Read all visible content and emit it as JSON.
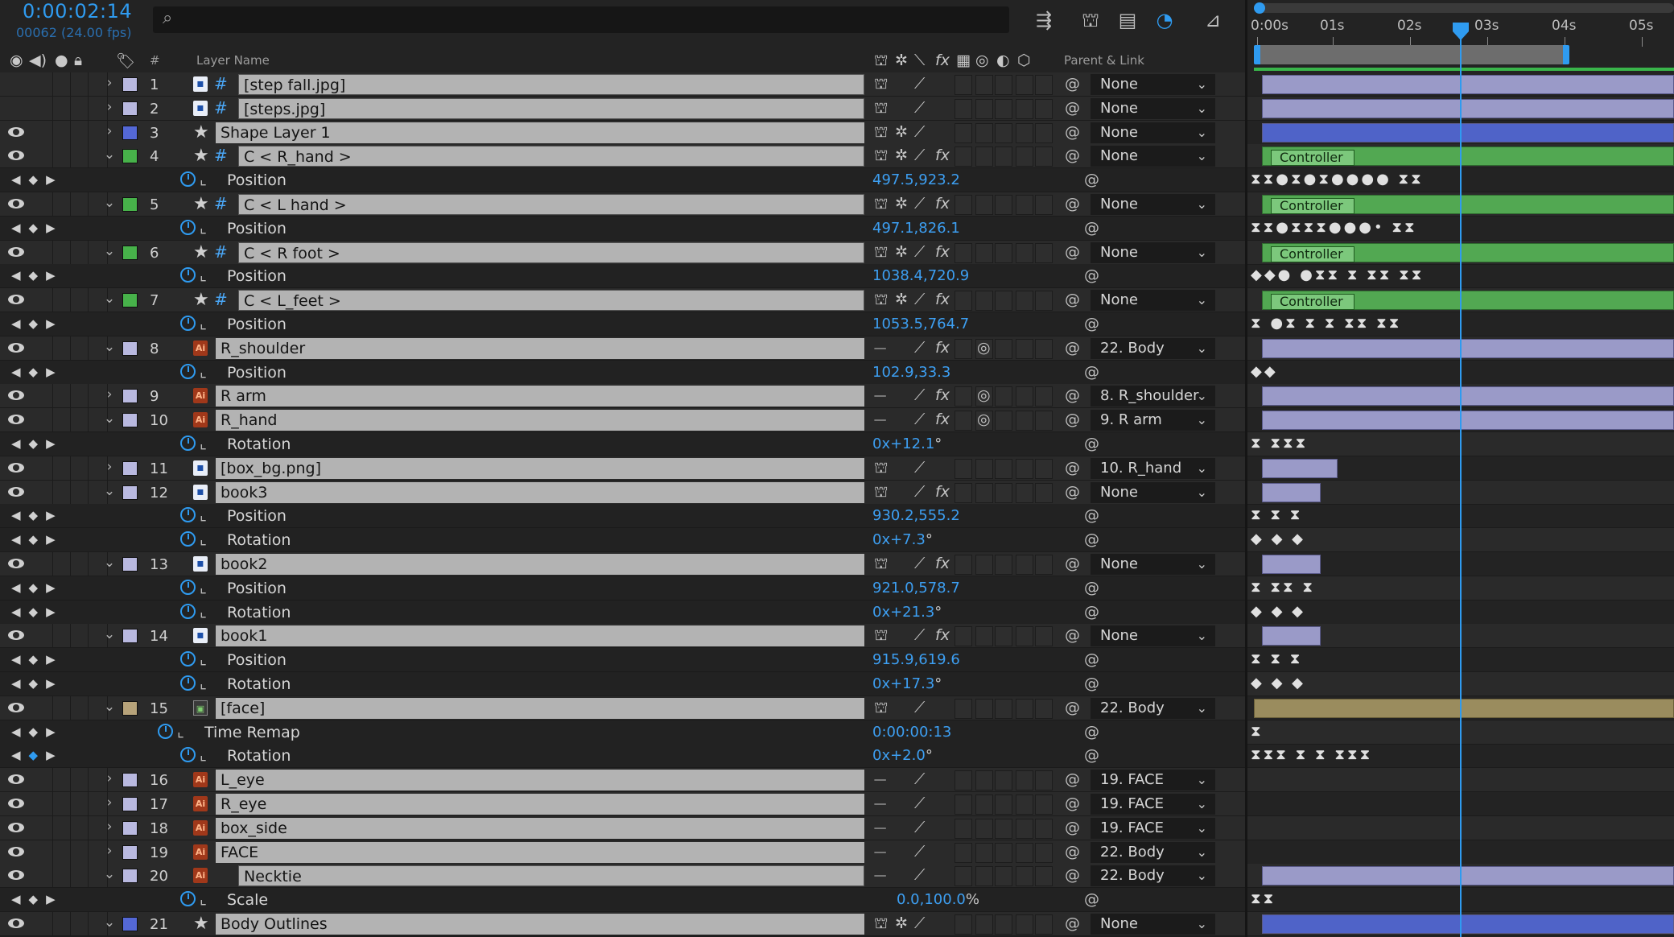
{
  "header": {
    "timecode": "0:00:02:14",
    "frame_info": "00062 (24.00 fps)",
    "search_placeholder": "",
    "col_layer_name": "Layer Name",
    "col_number": "#",
    "col_parent": "Parent & Link"
  },
  "ruler": {
    "ticks": [
      "0:00s",
      "01s",
      "02s",
      "03s",
      "04s",
      "05s"
    ]
  },
  "rows": [
    {
      "kind": "layer",
      "num": "1",
      "name": "[step fall.jpg]",
      "icon": "file",
      "hash": true,
      "color": "#b9b9e0",
      "twirl": "›",
      "parent": "None",
      "eye": false,
      "bar": "lav",
      "bar_start": 0.02,
      "bar_end": 1.0
    },
    {
      "kind": "layer",
      "num": "2",
      "name": "[steps.jpg]",
      "icon": "file",
      "hash": true,
      "color": "#b9b9e0",
      "twirl": "›",
      "parent": "None",
      "eye": false,
      "bar": "lav",
      "bar_start": 0.02,
      "bar_end": 1.0
    },
    {
      "kind": "layer",
      "num": "3",
      "name": "Shape Layer 1",
      "icon": "star",
      "hash": false,
      "color": "#5468d6",
      "twirl": "›",
      "parent": "None",
      "eye": true,
      "bar": "blue",
      "bar_start": 0.02,
      "bar_end": 1.0
    },
    {
      "kind": "layer",
      "num": "4",
      "name": "C < R_hand >",
      "icon": "star",
      "hash": true,
      "color": "#47b24a",
      "twirl": "⌄",
      "parent": "None",
      "eye": true,
      "bar": "green",
      "bar_start": 0.02,
      "bar_end": 1.0,
      "controller": "Controller"
    },
    {
      "kind": "prop",
      "name": "Position",
      "value": "497.5,923.2",
      "unit": "",
      "keys": "⧗⧗●⧗●⧗●●●● ⧗⧗"
    },
    {
      "kind": "layer",
      "num": "5",
      "name": "C < L hand >",
      "icon": "star",
      "hash": true,
      "color": "#47b24a",
      "twirl": "⌄",
      "parent": "None",
      "eye": true,
      "bar": "green",
      "bar_start": 0.02,
      "bar_end": 1.0,
      "controller": "Controller"
    },
    {
      "kind": "prop",
      "name": "Position",
      "value": "497.1,826.1",
      "unit": "",
      "keys": "⧗⧗●⧗⧗⧗●●●• ⧗⧗"
    },
    {
      "kind": "layer",
      "num": "6",
      "name": "C < R foot >",
      "icon": "star",
      "hash": true,
      "color": "#47b24a",
      "twirl": "⌄",
      "parent": "None",
      "eye": true,
      "bar": "green",
      "bar_start": 0.02,
      "bar_end": 1.0,
      "controller": "Controller"
    },
    {
      "kind": "prop",
      "name": "Position",
      "value": "1038.4,720.9",
      "unit": "",
      "keys": "◆◆● ●⧗⧗   ⧗ ⧗⧗ ⧗⧗"
    },
    {
      "kind": "layer",
      "num": "7",
      "name": "C < L_feet >",
      "icon": "star",
      "hash": true,
      "color": "#47b24a",
      "twirl": "⌄",
      "parent": "None",
      "eye": true,
      "bar": "green",
      "bar_start": 0.02,
      "bar_end": 1.0,
      "controller": "Controller"
    },
    {
      "kind": "prop",
      "name": "Position",
      "value": "1053.5,764.7",
      "unit": "",
      "keys": "⧗  ●⧗  ⧗   ⧗ ⧗⧗ ⧗⧗"
    },
    {
      "kind": "layer",
      "num": "8",
      "name": "R_shoulder",
      "icon": "ai",
      "hash": false,
      "color": "#b9b9e0",
      "twirl": "⌄",
      "parent": "22. Body",
      "eye": true,
      "bar": "lav",
      "bar_start": 0.02,
      "bar_end": 1.0
    },
    {
      "kind": "prop",
      "name": "Position",
      "value": "102.9,33.3",
      "unit": "",
      "keys": "                 ◆◆"
    },
    {
      "kind": "layer",
      "num": "9",
      "name": "R arm",
      "icon": "ai",
      "hash": false,
      "color": "#b9b9e0",
      "twirl": "›",
      "parent": "8. R_shoulder",
      "eye": true,
      "bar": "lav",
      "bar_start": 0.02,
      "bar_end": 1.0
    },
    {
      "kind": "layer",
      "num": "10",
      "name": "R_hand",
      "icon": "ai",
      "hash": false,
      "color": "#b9b9e0",
      "twirl": "⌄",
      "parent": "9. R arm",
      "eye": true,
      "bar": "lav",
      "bar_start": 0.02,
      "bar_end": 1.0
    },
    {
      "kind": "prop",
      "name": "Rotation",
      "value": "0x+12.1",
      "unit": "°",
      "keys": "                 ⧗ ⧗⧗⧗"
    },
    {
      "kind": "layer",
      "num": "11",
      "name": "[box_bg.png]",
      "icon": "file",
      "hash": false,
      "color": "#b9b9e0",
      "twirl": "›",
      "parent": "10. R_hand",
      "eye": true,
      "bar": "lav",
      "bar_start": 0.02,
      "bar_end": 0.2
    },
    {
      "kind": "layer",
      "num": "12",
      "name": "book3",
      "icon": "file",
      "hash": false,
      "color": "#b9b9e0",
      "twirl": "⌄",
      "parent": "None",
      "eye": true,
      "bar": "lav",
      "bar_start": 0.02,
      "bar_end": 0.16
    },
    {
      "kind": "prop",
      "name": "Position",
      "value": "930.2,555.2",
      "unit": "",
      "keys": "⧗  ⧗  ⧗"
    },
    {
      "kind": "prop",
      "name": "Rotation",
      "value": "0x+7.3",
      "unit": "°",
      "keys": " ◆  ◆  ◆"
    },
    {
      "kind": "layer",
      "num": "13",
      "name": "book2",
      "icon": "file",
      "hash": false,
      "color": "#b9b9e0",
      "twirl": "⌄",
      "parent": "None",
      "eye": true,
      "bar": "lav",
      "bar_start": 0.02,
      "bar_end": 0.16
    },
    {
      "kind": "prop",
      "name": "Position",
      "value": "921.0,578.7",
      "unit": "",
      "keys": "⧗  ⧗⧗  ⧗"
    },
    {
      "kind": "prop",
      "name": "Rotation",
      "value": "0x+21.3",
      "unit": "°",
      "keys": " ◆  ◆  ◆"
    },
    {
      "kind": "layer",
      "num": "14",
      "name": "book1",
      "icon": "file",
      "hash": false,
      "color": "#b9b9e0",
      "twirl": "⌄",
      "parent": "None",
      "eye": true,
      "bar": "lav",
      "bar_start": 0.02,
      "bar_end": 0.16
    },
    {
      "kind": "prop",
      "name": "Position",
      "value": "915.9,619.6",
      "unit": "",
      "keys": "⧗   ⧗ ⧗"
    },
    {
      "kind": "prop",
      "name": "Rotation",
      "value": "0x+17.3",
      "unit": "°",
      "keys": " ◆  ◆  ◆"
    },
    {
      "kind": "layer",
      "num": "15",
      "name": "[face]",
      "icon": "comp",
      "hash": false,
      "color": "#b7a37a",
      "twirl": "⌄",
      "parent": "22. Body",
      "eye": true,
      "bar": "tan",
      "bar_start": 0.0,
      "bar_end": 1.0
    },
    {
      "kind": "prop",
      "name": "Time Remap",
      "value": "0:00:00:13",
      "unit": "",
      "keys": "                  ⧗",
      "indent": true
    },
    {
      "kind": "prop",
      "name": "Rotation",
      "value": "0x+2.0",
      "unit": "°",
      "keys": "  ⧗⧗⧗ ⧗   ⧗  ⧗⧗⧗",
      "active": true
    },
    {
      "kind": "layer",
      "num": "16",
      "name": "L_eye",
      "icon": "ai",
      "hash": false,
      "color": "#b9b9e0",
      "twirl": "›",
      "parent": "19. FACE",
      "eye": true,
      "bar": "none"
    },
    {
      "kind": "layer",
      "num": "17",
      "name": "R_eye",
      "icon": "ai",
      "hash": false,
      "color": "#b9b9e0",
      "twirl": "›",
      "parent": "19. FACE",
      "eye": true,
      "bar": "none"
    },
    {
      "kind": "layer",
      "num": "18",
      "name": "box_side",
      "icon": "ai",
      "hash": false,
      "color": "#b9b9e0",
      "twirl": "›",
      "parent": "19. FACE",
      "eye": true,
      "bar": "none"
    },
    {
      "kind": "layer",
      "num": "19",
      "name": "FACE",
      "icon": "ai",
      "hash": false,
      "color": "#b9b9e0",
      "twirl": "›",
      "parent": "22. Body",
      "eye": true,
      "bar": "none"
    },
    {
      "kind": "layer",
      "num": "20",
      "name": "Necktie",
      "icon": "ai",
      "hash": false,
      "color": "#b9b9e0",
      "twirl": "⌄",
      "parent": "22. Body",
      "eye": true,
      "bar": "lav",
      "bar_start": 0.02,
      "bar_end": 1.0,
      "boxed": true
    },
    {
      "kind": "prop",
      "name": "Scale",
      "value": "0.0,100.0",
      "unit": "%",
      "keys": "                  ⧗⧗"
    },
    {
      "kind": "layer",
      "num": "21",
      "name": "Body Outlines",
      "icon": "star",
      "hash": false,
      "color": "#5468d6",
      "twirl": "⌄",
      "parent": "None",
      "eye": true,
      "bar": "blue",
      "bar_start": 0.02,
      "bar_end": 1.0
    }
  ],
  "playhead_fraction": 0.49,
  "colors": {
    "accent": "#2f9bf0",
    "work_area_green": "#39b54a"
  }
}
